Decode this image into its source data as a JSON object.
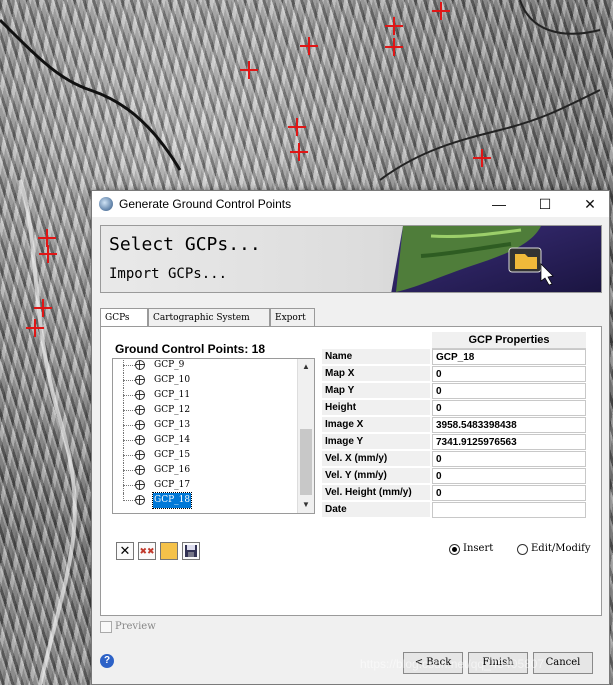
{
  "window": {
    "title": "Generate Ground Control Points",
    "controls": {
      "minimize": "—",
      "maximize": "☐",
      "close": "✕"
    }
  },
  "banner": {
    "select_text": "Select GCPs...",
    "import_text": "Import GCPs..."
  },
  "tabs": [
    {
      "label": "GCPs",
      "active": true
    },
    {
      "label": "Cartographic System",
      "active": false
    },
    {
      "label": "Export",
      "active": false
    }
  ],
  "gcp_panel": {
    "heading": "Ground Control Points: 18",
    "visible_items": [
      "GCP_9",
      "GCP_10",
      "GCP_11",
      "GCP_12",
      "GCP_13",
      "GCP_14",
      "GCP_15",
      "GCP_16",
      "GCP_17",
      "GCP_18"
    ],
    "selected": "GCP_18"
  },
  "properties": {
    "header": "GCP Properties",
    "rows": [
      {
        "name": "Name",
        "value": "GCP_18"
      },
      {
        "name": "Map X",
        "value": "0"
      },
      {
        "name": "Map Y",
        "value": "0"
      },
      {
        "name": "Height",
        "value": "0"
      },
      {
        "name": "Image X",
        "value": "3958.5483398438"
      },
      {
        "name": "Image Y",
        "value": "7341.9125976563"
      },
      {
        "name": "Vel. X (mm/y)",
        "value": "0"
      },
      {
        "name": "Vel. Y (mm/y)",
        "value": "0"
      },
      {
        "name": "Vel. Height (mm/y)",
        "value": "0"
      },
      {
        "name": "Date",
        "value": ""
      }
    ]
  },
  "toolbar_icons": [
    "delete-icon",
    "delete-all-icon",
    "open-folder-icon",
    "save-icon"
  ],
  "mode": {
    "insert_label": "Insert",
    "edit_label": "Edit/Modify",
    "selected": "Insert"
  },
  "preview": {
    "label": "Preview",
    "checked": false
  },
  "buttons": {
    "back": "< Back",
    "finish": "Finish",
    "cancel": "Cancel"
  },
  "watermark": "https://blog.csdn.net/qq_45405807"
}
